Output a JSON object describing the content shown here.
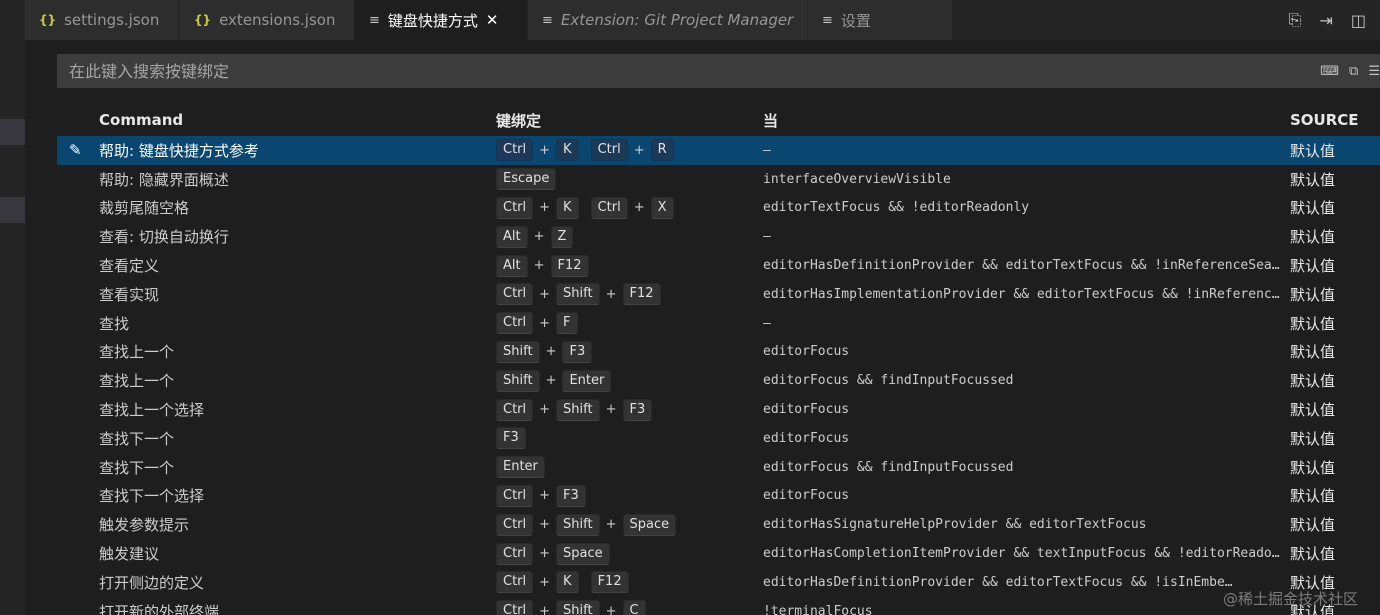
{
  "tabs": [
    {
      "name": "tab-settings-json",
      "label": "settings.json",
      "icon": "json-braces-icon",
      "icon_glyph": "{}",
      "active": false,
      "italic": false
    },
    {
      "name": "tab-extensions-json",
      "label": "extensions.json",
      "icon": "json-braces-icon",
      "icon_glyph": "{}",
      "active": false,
      "italic": false
    },
    {
      "name": "tab-keyboard-shortcuts",
      "label": "键盘快捷方式",
      "icon": "lines-icon",
      "icon_glyph": "≡",
      "active": true,
      "italic": false
    },
    {
      "name": "tab-extension-git-project-manager",
      "label": "Extension: Git Project Manager",
      "icon": "lines-icon",
      "icon_glyph": "≡",
      "active": false,
      "italic": true
    },
    {
      "name": "tab-settings-zh",
      "label": "设置",
      "icon": "lines-icon",
      "icon_glyph": "≡",
      "active": false,
      "italic": false
    }
  ],
  "close_glyph": "✕",
  "search": {
    "placeholder": "在此键入搜索按键绑定",
    "value": ""
  },
  "headers": {
    "command": "Command",
    "keybinding": "键绑定",
    "when": "当",
    "source": "SOURCE"
  },
  "rows": [
    {
      "command": "帮助: 键盘快捷方式参考",
      "keys": [
        [
          "Ctrl",
          "K"
        ],
        [
          "Ctrl",
          "R"
        ]
      ],
      "when": "—",
      "source": "默认值",
      "selected": true
    },
    {
      "command": "帮助: 隐藏界面概述",
      "keys": [
        [
          "Escape"
        ]
      ],
      "when": "interfaceOverviewVisible",
      "source": "默认值"
    },
    {
      "command": "裁剪尾随空格",
      "keys": [
        [
          "Ctrl",
          "K"
        ],
        [
          "Ctrl",
          "X"
        ]
      ],
      "when": "editorTextFocus && !editorReadonly",
      "source": "默认值"
    },
    {
      "command": "查看: 切换自动换行",
      "keys": [
        [
          "Alt",
          "Z"
        ]
      ],
      "when": "—",
      "source": "默认值"
    },
    {
      "command": "查看定义",
      "keys": [
        [
          "Alt",
          "F12"
        ]
      ],
      "when": "editorHasDefinitionProvider && editorTextFocus && !inReferenceSear…",
      "source": "默认值"
    },
    {
      "command": "查看实现",
      "keys": [
        [
          "Ctrl",
          "Shift",
          "F12"
        ]
      ],
      "when": "editorHasImplementationProvider && editorTextFocus && !inReference…",
      "source": "默认值"
    },
    {
      "command": "查找",
      "keys": [
        [
          "Ctrl",
          "F"
        ]
      ],
      "when": "—",
      "source": "默认值"
    },
    {
      "command": "查找上一个",
      "keys": [
        [
          "Shift",
          "F3"
        ]
      ],
      "when": "editorFocus",
      "source": "默认值"
    },
    {
      "command": "查找上一个",
      "keys": [
        [
          "Shift",
          "Enter"
        ]
      ],
      "when": "editorFocus && findInputFocussed",
      "source": "默认值"
    },
    {
      "command": "查找上一个选择",
      "keys": [
        [
          "Ctrl",
          "Shift",
          "F3"
        ]
      ],
      "when": "editorFocus",
      "source": "默认值"
    },
    {
      "command": "查找下一个",
      "keys": [
        [
          "F3"
        ]
      ],
      "when": "editorFocus",
      "source": "默认值"
    },
    {
      "command": "查找下一个",
      "keys": [
        [
          "Enter"
        ]
      ],
      "when": "editorFocus && findInputFocussed",
      "source": "默认值"
    },
    {
      "command": "查找下一个选择",
      "keys": [
        [
          "Ctrl",
          "F3"
        ]
      ],
      "when": "editorFocus",
      "source": "默认值"
    },
    {
      "command": "触发参数提示",
      "keys": [
        [
          "Ctrl",
          "Shift",
          "Space"
        ]
      ],
      "when": "editorHasSignatureHelpProvider && editorTextFocus",
      "source": "默认值"
    },
    {
      "command": "触发建议",
      "keys": [
        [
          "Ctrl",
          "Space"
        ]
      ],
      "when": "editorHasCompletionItemProvider && textInputFocus && !editorReadon…",
      "source": "默认值"
    },
    {
      "command": "打开侧边的定义",
      "keys": [
        [
          "Ctrl",
          "K"
        ],
        [
          "F12"
        ]
      ],
      "when": "editorHasDefinitionProvider && editorTextFocus && !isInEmbe…",
      "source": "默认值"
    },
    {
      "command": "打开新的外部终端",
      "keys": [
        [
          "Ctrl",
          "Shift",
          "C"
        ]
      ],
      "when": "!terminalFocus",
      "source": "默认值"
    }
  ],
  "watermark": "@稀土掘金技术社区"
}
